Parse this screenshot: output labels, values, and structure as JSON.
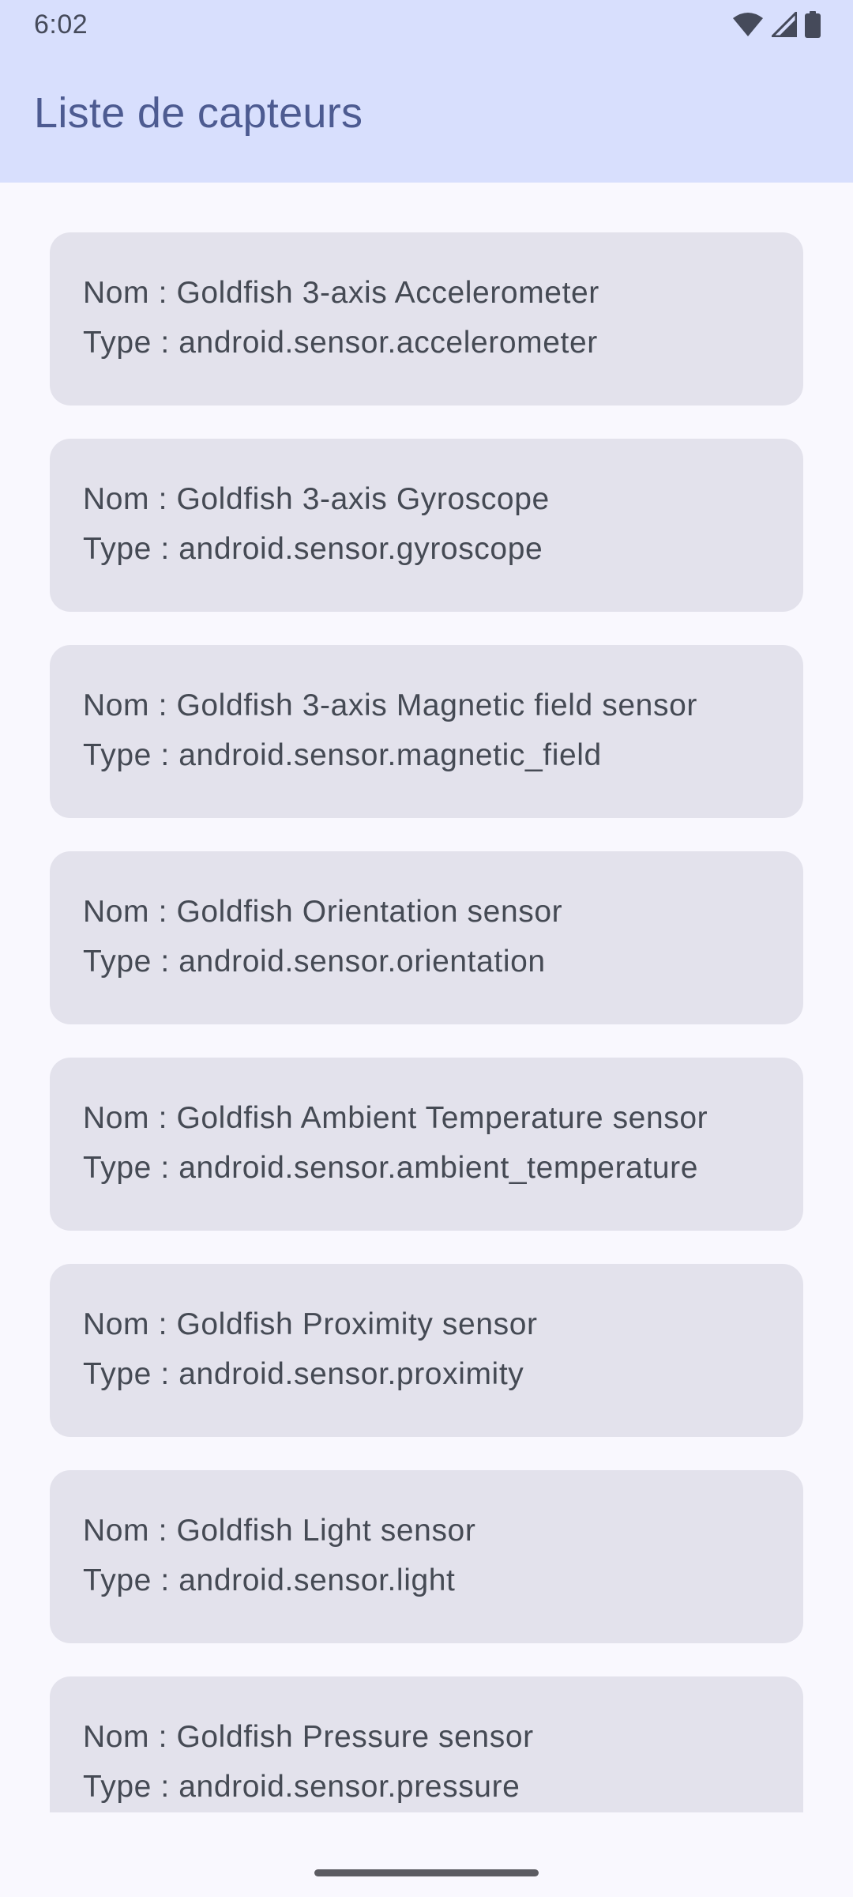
{
  "status_bar": {
    "time": "6:02",
    "icons": [
      "wifi-icon",
      "cell-signal-icon",
      "battery-icon"
    ]
  },
  "app_bar": {
    "title": "Liste de capteurs"
  },
  "sensors": [
    {
      "name": "Nom : Goldfish 3-axis Accelerometer",
      "type": "Type : android.sensor.accelerometer"
    },
    {
      "name": "Nom : Goldfish 3-axis Gyroscope",
      "type": "Type : android.sensor.gyroscope"
    },
    {
      "name": "Nom : Goldfish 3-axis Magnetic field sensor",
      "type": "Type : android.sensor.magnetic_field"
    },
    {
      "name": "Nom : Goldfish Orientation sensor",
      "type": "Type : android.sensor.orientation"
    },
    {
      "name": "Nom : Goldfish Ambient Temperature sensor",
      "type": "Type : android.sensor.ambient_temperature"
    },
    {
      "name": "Nom : Goldfish Proximity sensor",
      "type": "Type : android.sensor.proximity"
    },
    {
      "name": "Nom : Goldfish Light sensor",
      "type": "Type : android.sensor.light"
    },
    {
      "name": "Nom : Goldfish Pressure sensor",
      "type": "Type : android.sensor.pressure"
    }
  ],
  "colors": {
    "app_bar_bg": "#d8dffd",
    "title": "#4d5b91",
    "card_bg": "#e3e2ec",
    "page_bg": "#f9f8fe"
  }
}
